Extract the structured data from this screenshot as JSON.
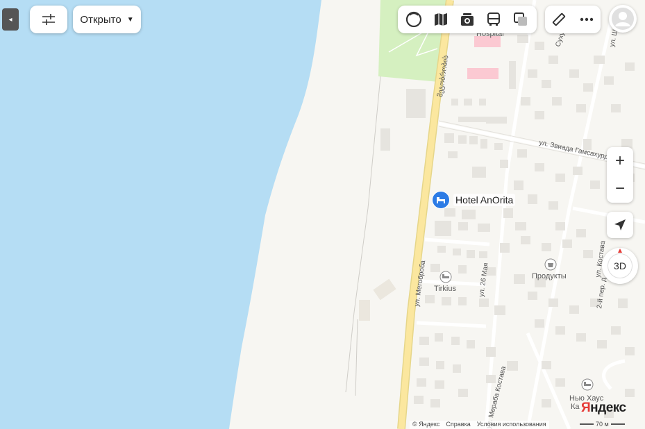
{
  "toolbar": {
    "open_filter_label": "Открыто",
    "open_filter_caret": "▼",
    "collapse_glyph": "◂"
  },
  "layers": [
    {
      "name": "traffic-layer-icon"
    },
    {
      "name": "map-layer-icon"
    },
    {
      "name": "panorama-layer-icon"
    },
    {
      "name": "transport-layer-icon"
    },
    {
      "name": "layers-switch-icon"
    }
  ],
  "tools": [
    {
      "name": "ruler-icon"
    },
    {
      "name": "more-icon"
    }
  ],
  "zoom": {
    "in_label": "+",
    "out_label": "−"
  },
  "view3d": {
    "label": "3D"
  },
  "map": {
    "pois": {
      "hotel_anorita": "Hotel AnOrita",
      "tirkius": "Tirkius",
      "produkty": "Продукты",
      "new_house": "Нью Хаус",
      "new_house_line2": "Ка",
      "hospital": "Hospital"
    },
    "streets": {
      "megobroba": "ул. Мегоброба",
      "megobroba_georgian": "მეგობრობის",
      "zviad": "ул. Звиада Гамсахурдия",
      "may26": "ул. 26 Мая",
      "kostava": "ул. Мераба Костава",
      "kostava_short": "ул. Костава",
      "lane2": "2-й пер. д",
      "sukhumi": "Сухуми",
      "top_right": "ул. Ш"
    }
  },
  "footer": {
    "copyright": "© Яндекс",
    "help": "Справка",
    "terms": "Условия использования",
    "scale_label": "70 м"
  },
  "brand": {
    "first_letter": "Я",
    "rest": "ндекс"
  },
  "colors": {
    "water": "#b5ddf4",
    "land": "#f7f6f2",
    "main_road": "#fbe79f",
    "park": "#d5f0c0",
    "building": "#e6e4df",
    "hospital": "#fbc9d2",
    "hotel_pin": "#2c7be5",
    "brand_red": "#e53935"
  }
}
